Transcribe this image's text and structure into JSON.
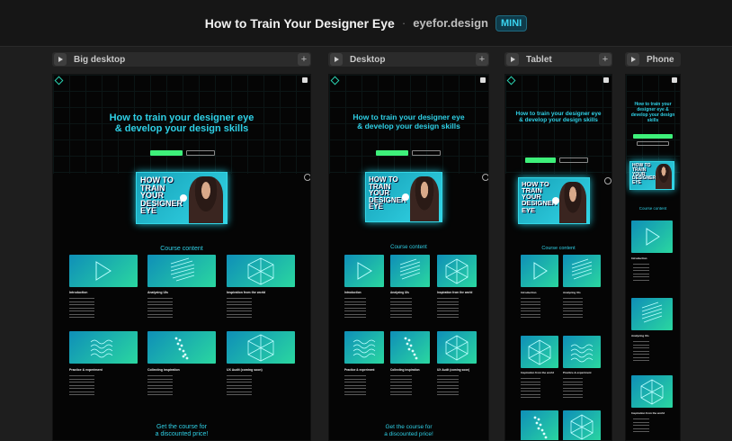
{
  "topbar": {
    "title": "How to Train Your Designer Eye",
    "separator": "·",
    "site": "eyefor.design",
    "badge": "MINI"
  },
  "columns": [
    {
      "label": "Big desktop"
    },
    {
      "label": "Desktop"
    },
    {
      "label": "Tablet"
    },
    {
      "label": "Phone"
    }
  ],
  "page": {
    "hero_line1": "How to train your designer eye",
    "hero_line2": "& develop your design skills",
    "hero_phone": "How to train your designer eye & develop your design skills",
    "video_text": "HOW TO TRAIN YOUR DESIGNER EYE",
    "video_text_lines": [
      "HOW TO",
      "TRAIN",
      "YOUR",
      "DESIGNER",
      "EYE"
    ],
    "section_title": "Course content",
    "cards": [
      {
        "title": "Introduction",
        "icon": "play-icon"
      },
      {
        "title": "Analyzing UIs",
        "icon": "diagonal-lines-icon"
      },
      {
        "title": "Inspiration from the world",
        "icon": "cube-icon"
      },
      {
        "title": "Practice & experiment",
        "icon": "wave-lines-icon"
      },
      {
        "title": "Collecting inspiration",
        "icon": "dots-icon"
      },
      {
        "title": "UX Audit (coming soon)",
        "icon": "hexagon-icon"
      }
    ],
    "cta_line1": "Get the course for",
    "cta_line2": "a discounted price!"
  },
  "colors": {
    "accent": "#2fd0e6",
    "green": "#3ef07a",
    "background": "#050505"
  }
}
